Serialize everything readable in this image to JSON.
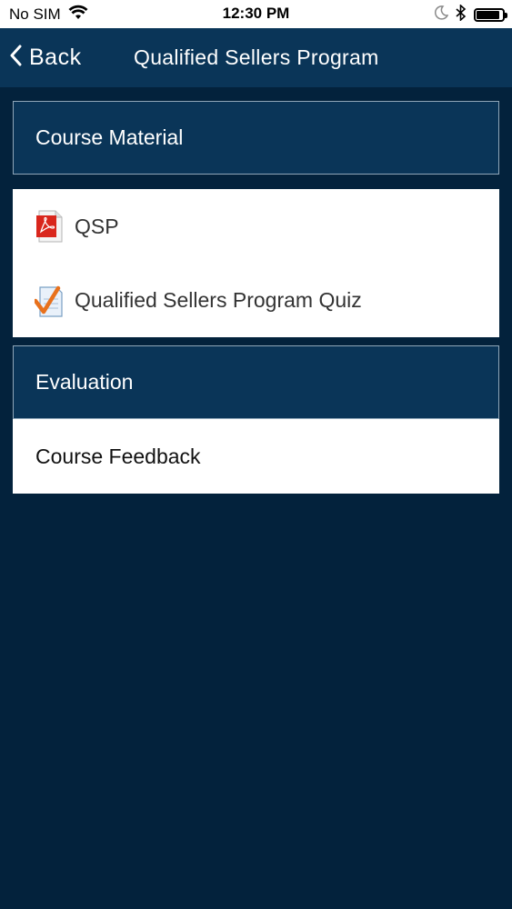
{
  "status_bar": {
    "carrier": "No SIM",
    "time": "12:30 PM",
    "battery_level": 0.9,
    "icons": [
      "wifi-icon",
      "moon-icon",
      "bluetooth-icon",
      "battery-icon"
    ]
  },
  "nav": {
    "back_label": "Back",
    "title": "Qualified Sellers Program"
  },
  "sections": {
    "course_material": {
      "title": "Course Material",
      "items": [
        {
          "label": "QSP",
          "icon": "pdf-file-icon"
        },
        {
          "label": "Qualified Sellers Program Quiz",
          "icon": "quiz-checkmark-icon"
        }
      ]
    },
    "evaluation": {
      "title": "Evaluation",
      "items": [
        {
          "label": "Course Feedback"
        }
      ]
    }
  },
  "colors": {
    "background": "#03223c",
    "nav_bar": "#0a3558",
    "header_border": "#8fa6b8",
    "pdf_red": "#d9261c",
    "checkmark_orange": "#e8711c"
  }
}
